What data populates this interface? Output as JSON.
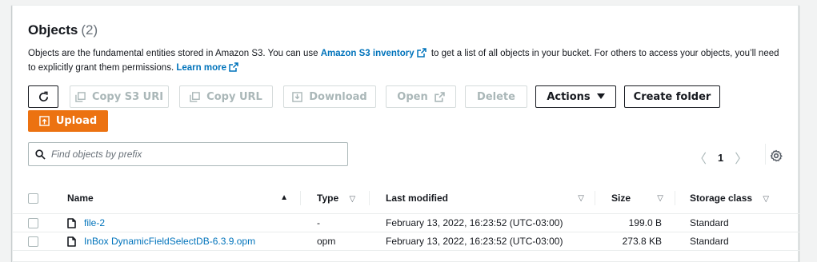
{
  "header": {
    "title": "Objects",
    "count": "(2)"
  },
  "description": {
    "text1": "Objects are the fundamental entities stored in Amazon S3. You can use ",
    "inventory_link": "Amazon S3 inventory",
    "text2": " to get a list of all objects in your bucket. For others to access your objects, you’ll need to explicitly grant them permissions. ",
    "learn_more": "Learn more"
  },
  "toolbar": {
    "copy_s3_uri": "Copy S3 URI",
    "copy_url": "Copy URL",
    "download": "Download",
    "open": "Open",
    "delete": "Delete",
    "actions": "Actions",
    "create_folder": "Create folder",
    "upload": "Upload"
  },
  "search": {
    "placeholder": "Find objects by prefix",
    "value": ""
  },
  "pagination": {
    "current_page": "1"
  },
  "table": {
    "columns": {
      "name": "Name",
      "type": "Type",
      "last_modified": "Last modified",
      "size": "Size",
      "storage_class": "Storage class"
    },
    "rows": [
      {
        "name": "file-2",
        "type": "-",
        "last_modified": "February 13, 2022, 16:23:52 (UTC-03:00)",
        "size": "199.0 B",
        "storage_class": "Standard"
      },
      {
        "name": "InBox DynamicFieldSelectDB-6.3.9.opm",
        "type": "opm",
        "last_modified": "February 13, 2022, 16:23:52 (UTC-03:00)",
        "size": "273.8 KB",
        "storage_class": "Standard"
      }
    ]
  },
  "colors": {
    "accent": "#ec7211",
    "link": "#0073bb",
    "disabled": "#aab7b8"
  },
  "icons": [
    "refresh-icon",
    "copy-icon",
    "download-icon",
    "external-link-icon",
    "caret-down-icon",
    "upload-icon",
    "search-icon",
    "chevron-left-icon",
    "chevron-right-icon",
    "gear-icon",
    "sort-icon",
    "file-icon"
  ]
}
